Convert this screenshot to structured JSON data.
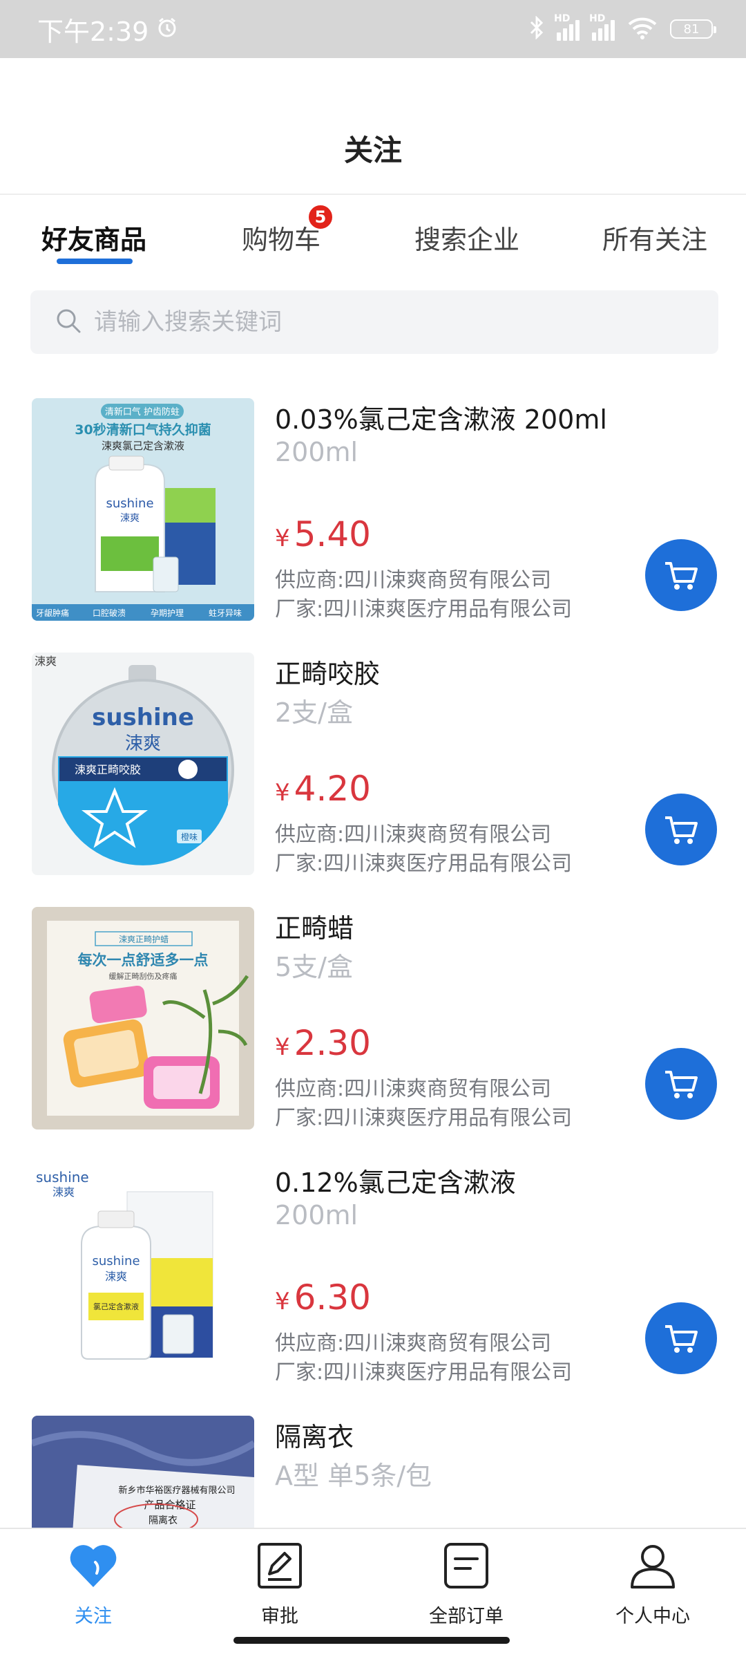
{
  "status_bar": {
    "time": "下午2:39",
    "battery": "81"
  },
  "header": {
    "title": "关注"
  },
  "tabs": [
    {
      "label": "好友商品",
      "active": true
    },
    {
      "label": "购物车",
      "badge": "5"
    },
    {
      "label": "搜索企业"
    },
    {
      "label": "所有关注"
    }
  ],
  "search": {
    "placeholder": "请输入搜索关键词",
    "value": ""
  },
  "products": [
    {
      "name": "0.03%氯己定含漱液 200ml",
      "spec": "200ml",
      "currency": "¥",
      "price": "5.40",
      "supplier": "供应商:四川涑爽商贸有限公司",
      "maker": "厂家:四川涑爽医疗用品有限公司",
      "image_text": [
        "清新口气 护齿防蛀",
        "30秒清新口气持久抑菌",
        "涑爽氯己定含漱液",
        "sushine",
        "涑爽",
        "牙龈肿痛",
        "口腔破溃",
        "孕期护理",
        "蛀牙异味"
      ]
    },
    {
      "name": "正畸咬胶",
      "spec": "2支/盒",
      "currency": "¥",
      "price": "4.20",
      "supplier": "供应商:四川涑爽商贸有限公司",
      "maker": "厂家:四川涑爽医疗用品有限公司",
      "image_text": [
        "涑爽",
        "sushine",
        "涑爽",
        "涑爽正畸咬胶",
        "橙味"
      ]
    },
    {
      "name": "正畸蜡",
      "spec": "5支/盒",
      "currency": "¥",
      "price": "2.30",
      "supplier": "供应商:四川涑爽商贸有限公司",
      "maker": "厂家:四川涑爽医疗用品有限公司",
      "image_text": [
        "涑爽正畸护蜡",
        "每次一点舒适多一点",
        "缓解正畸刮伤及疼痛"
      ]
    },
    {
      "name": "0.12%氯己定含漱液",
      "spec": "200ml",
      "currency": "¥",
      "price": "6.30",
      "supplier": "供应商:四川涑爽商贸有限公司",
      "maker": "厂家:四川涑爽医疗用品有限公司",
      "image_text": [
        "sushine",
        "涑爽",
        "sushine",
        "涑爽",
        "氯己定含漱液"
      ]
    },
    {
      "name": "隔离衣",
      "spec": "A型 单5条/包",
      "currency": "",
      "price": "",
      "supplier": "",
      "maker": "",
      "image_text": [
        "新乡市华裕医疗器械有限公司",
        "产品合格证",
        "隔离衣"
      ]
    }
  ],
  "bottom_nav": [
    {
      "label": "关注",
      "icon": "heart-icon",
      "active": true
    },
    {
      "label": "审批",
      "icon": "edit-icon"
    },
    {
      "label": "全部订单",
      "icon": "order-list-icon"
    },
    {
      "label": "个人中心",
      "icon": "user-icon"
    }
  ],
  "colors": {
    "primary": "#1e6fd9",
    "price": "#d9363e",
    "badge": "#e2231a",
    "nav_active": "#2f8ff0"
  }
}
